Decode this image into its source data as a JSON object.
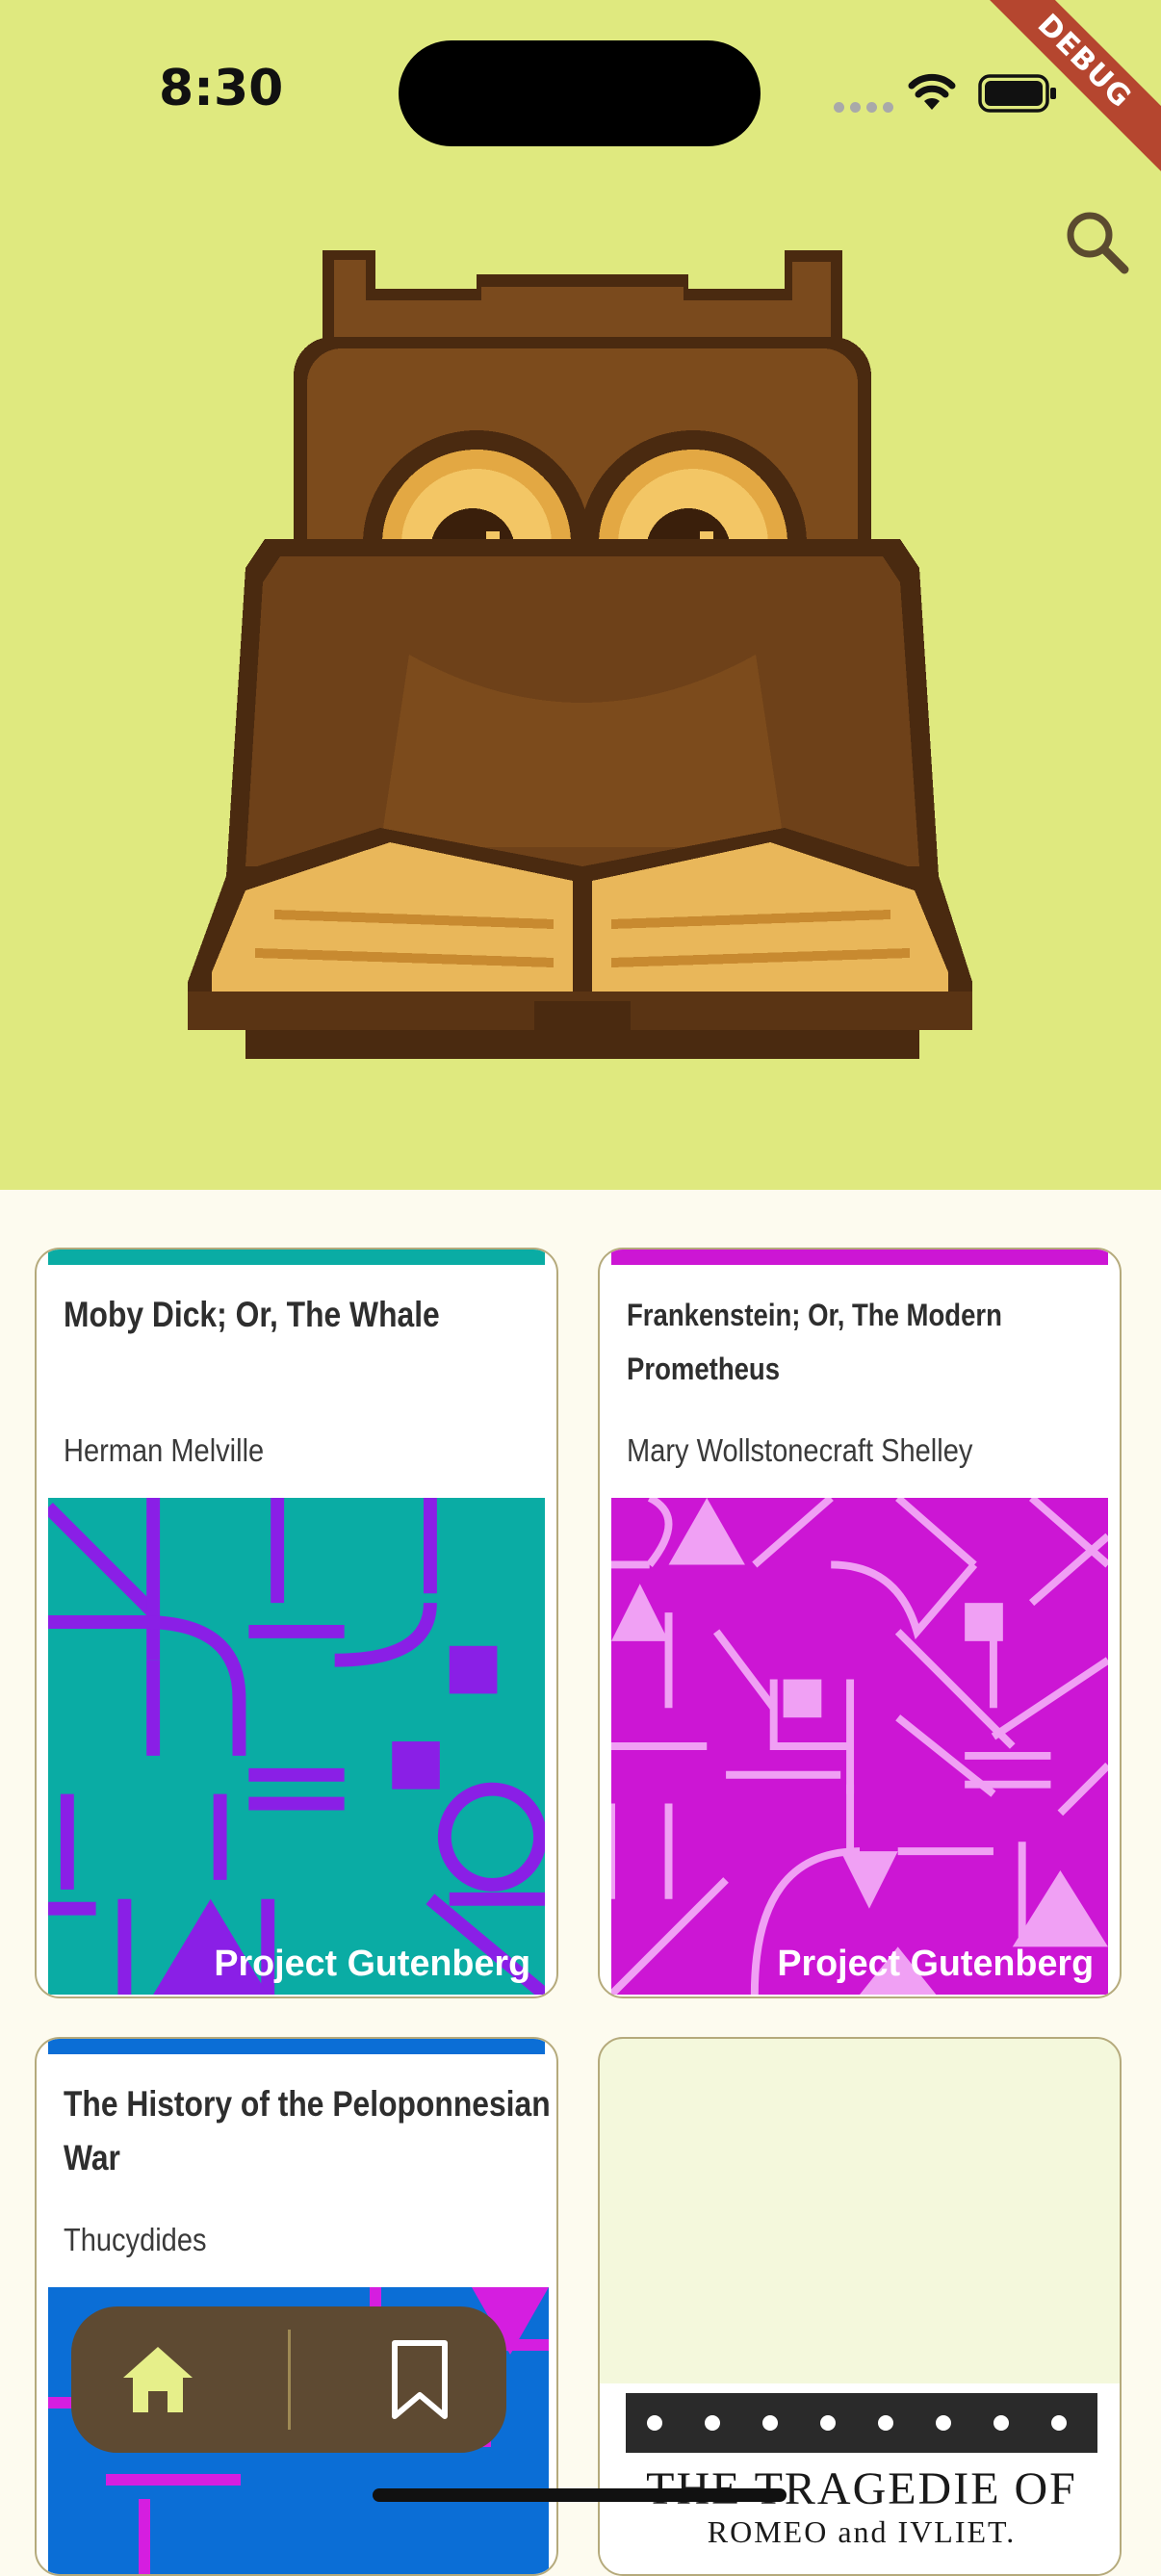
{
  "status_bar": {
    "time": "8:30",
    "debug_label": "DEBUG"
  },
  "header": {
    "background": "#dfe97f",
    "search_icon": "search-icon",
    "hero_image": "owl-reading-book"
  },
  "books": [
    {
      "title": "Moby Dick; Or, The Whale",
      "author": "Herman Melville",
      "accent": "#0aaca4",
      "cover_label": "Project Gutenberg"
    },
    {
      "title": "Frankenstein; Or, The Modern Prometheus",
      "author": "Mary Wollstonecraft Shelley",
      "accent": "#cc16d4",
      "cover_label": "Project Gutenberg"
    },
    {
      "title": "The History of the Peloponnesian War",
      "author": "Thucydides",
      "accent": "#0b6ed6",
      "cover_label": ""
    },
    {
      "title": "",
      "author": "",
      "accent": "",
      "cover_label": "",
      "cover_text_1": "THE TRAGEDIE OF",
      "cover_text_2": "ROMEO and IVLIET."
    }
  ],
  "bottom_nav": {
    "items": [
      {
        "icon": "home-icon",
        "active": true
      },
      {
        "icon": "bookmark-icon",
        "active": false
      }
    ]
  }
}
